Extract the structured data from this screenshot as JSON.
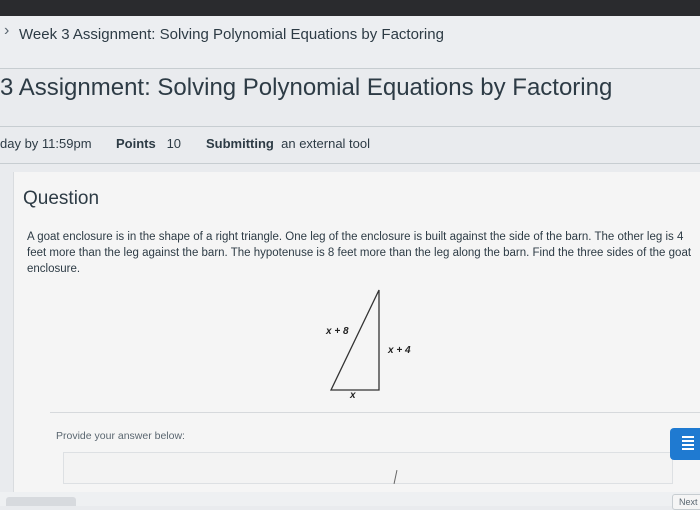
{
  "breadcrumb": {
    "text": "Week 3 Assignment: Solving Polynomial Equations by Factoring"
  },
  "page_title": "3 Assignment: Solving Polynomial Equations by Factoring",
  "meta": {
    "due_text": "day by 11:59pm",
    "points_label": "Points",
    "points_value": "10",
    "submitting_label": "Submitting",
    "submitting_value": "an external tool"
  },
  "question": {
    "heading": "Question",
    "text": "A goat enclosure is in the shape of a right triangle. One leg of the enclosure is built against the side of the barn. The other leg is 4 feet more than the leg against the barn. The hypotenuse is 8 feet more than the leg along the barn. Find the three sides of the goat enclosure.",
    "diagram": {
      "label_left": "x + 8",
      "label_right": "x + 4",
      "label_bottom": "x"
    },
    "provide_label": "Provide your answer below:"
  },
  "footer": {
    "next_label": "Next"
  },
  "colors": {
    "accent": "#1f7ad1",
    "topbar": "#2a2b2e"
  }
}
